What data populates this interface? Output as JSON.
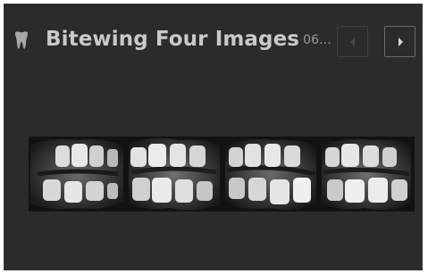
{
  "panel": {
    "title": "Bitewing Four Images",
    "date_truncated": "06...",
    "icon": "tooth-icon"
  },
  "navigation": {
    "prev_icon": "chevron-left-icon",
    "next_icon": "chevron-right-icon",
    "prev_enabled": false,
    "next_enabled": true
  },
  "images": [
    {
      "name": "bitewing-image-1"
    },
    {
      "name": "bitewing-image-2"
    },
    {
      "name": "bitewing-image-3"
    },
    {
      "name": "bitewing-image-4"
    }
  ],
  "colors": {
    "panel_bg": "#2b2b2b",
    "title": "#c9c9c9",
    "date": "#9a9a9a"
  }
}
